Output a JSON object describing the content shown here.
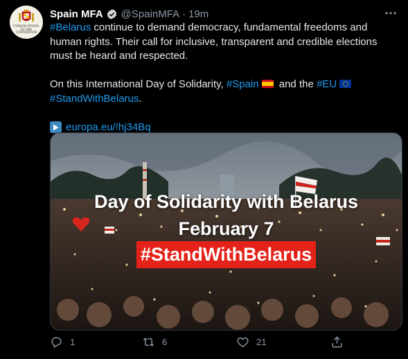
{
  "account": {
    "name": "Spain MFA",
    "handle": "@SpainMFA",
    "separator": "·",
    "time": "19m",
    "avatar_text": "FOREIGN AFFAIRS, EU AND COOPERATION",
    "verified": true
  },
  "tweet": {
    "line1_tag": "#Belarus",
    "line1_text": " continue to demand democracy, fundamental freedoms and human rights. Their call for inclusive, transparent and credible elections must be heard and respected.",
    "line2_prefix": "On this International Day of Solidarity, ",
    "line2_tag_spain": "#Spain",
    "line2_mid": " and the ",
    "line2_tag_eu": "#EU",
    "line3_tag": "#StandWithBelarus",
    "line3_end": ".",
    "link": "europa.eu/!hj34Bq"
  },
  "media": {
    "title_line1": "Day of Solidarity with Belarus",
    "title_line2": "February 7",
    "hashtag": "#StandWithBelarus"
  },
  "actions": {
    "reply_count": "1",
    "retweet_count": "6",
    "like_count": "21"
  },
  "colors": {
    "accent": "#1d9bf0",
    "background": "#000000",
    "muted": "#8b98a5",
    "banner_red": "#e52219"
  }
}
